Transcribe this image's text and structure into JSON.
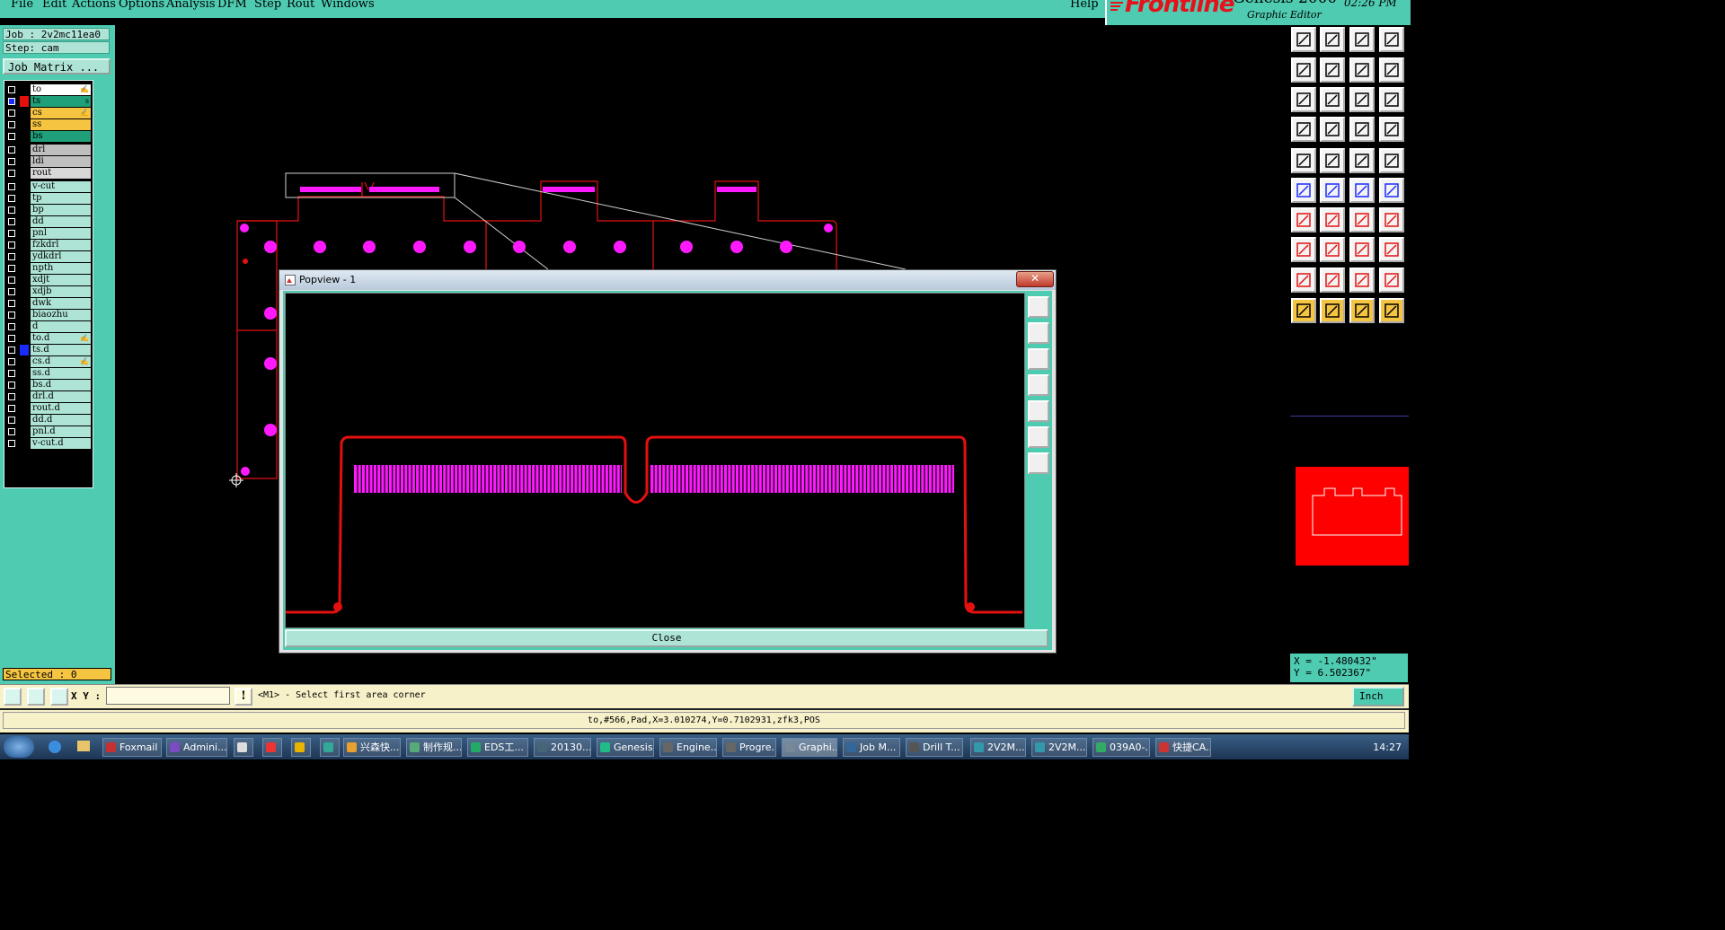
{
  "menu": [
    "File",
    "Edit",
    "Actions",
    "Options",
    "Analysis",
    "DFM",
    "Step",
    "Rout",
    "Windows"
  ],
  "help": "Help",
  "brand": {
    "logo": "Frontline",
    "product": "Genesis 2000",
    "subtitle": "Graphic Editor",
    "time": "02:26 PM"
  },
  "job": {
    "job_label": "Job : 2v2mc11ea0",
    "step_label": "Step: cam",
    "job_matrix": "Job Matrix ..."
  },
  "layers": [
    {
      "name": "to",
      "color": "#ffffff",
      "swatch": "#000000",
      "edit": "✍"
    },
    {
      "name": "ts",
      "color": "#1fa07a",
      "swatch": "#e41010",
      "edit": "s",
      "active": true
    },
    {
      "name": "cs",
      "color": "#f5c542",
      "swatch": "#000000",
      "edit": "✍"
    },
    {
      "name": "ss",
      "color": "#f5c542",
      "swatch": "#000000",
      "edit": ""
    },
    {
      "name": "bs",
      "color": "#1fa07a",
      "swatch": "#000000",
      "edit": ""
    },
    {
      "name": "drl",
      "color": "#bfbfbf",
      "swatch": "#000000",
      "edit": ""
    },
    {
      "name": "ldi",
      "color": "#bfbfbf",
      "swatch": "#000000",
      "edit": ""
    },
    {
      "name": "rout",
      "color": "#d8d8d8",
      "swatch": "#000000",
      "edit": ""
    },
    {
      "name": "v-cut",
      "color": "#aee4d6",
      "swatch": "#000000",
      "edit": ""
    },
    {
      "name": "tp",
      "color": "#aee4d6",
      "swatch": "#000000",
      "edit": ""
    },
    {
      "name": "bp",
      "color": "#aee4d6",
      "swatch": "#000000",
      "edit": ""
    },
    {
      "name": "dd",
      "color": "#aee4d6",
      "swatch": "#000000",
      "edit": ""
    },
    {
      "name": "pnl",
      "color": "#aee4d6",
      "swatch": "#000000",
      "edit": ""
    },
    {
      "name": "fzkdrl",
      "color": "#aee4d6",
      "swatch": "#000000",
      "edit": ""
    },
    {
      "name": "ydkdrl",
      "color": "#aee4d6",
      "swatch": "#000000",
      "edit": ""
    },
    {
      "name": "npth",
      "color": "#aee4d6",
      "swatch": "#000000",
      "edit": ""
    },
    {
      "name": "xdjt",
      "color": "#aee4d6",
      "swatch": "#000000",
      "edit": ""
    },
    {
      "name": "xdjb",
      "color": "#aee4d6",
      "swatch": "#000000",
      "edit": ""
    },
    {
      "name": "dwk",
      "color": "#aee4d6",
      "swatch": "#000000",
      "edit": ""
    },
    {
      "name": "biaozhu",
      "color": "#aee4d6",
      "swatch": "#000000",
      "edit": ""
    },
    {
      "name": "d",
      "color": "#aee4d6",
      "swatch": "#000000",
      "edit": ""
    },
    {
      "name": "to.d",
      "color": "#aee4d6",
      "swatch": "#000000",
      "edit": "✍"
    },
    {
      "name": "ts.d",
      "color": "#aee4d6",
      "swatch": "#1a2bff",
      "edit": ""
    },
    {
      "name": "cs.d",
      "color": "#aee4d6",
      "swatch": "#000000",
      "edit": "✍"
    },
    {
      "name": "ss.d",
      "color": "#aee4d6",
      "swatch": "#000000",
      "edit": ""
    },
    {
      "name": "bs.d",
      "color": "#aee4d6",
      "swatch": "#000000",
      "edit": ""
    },
    {
      "name": "drl.d",
      "color": "#aee4d6",
      "swatch": "#000000",
      "edit": ""
    },
    {
      "name": "rout.d",
      "color": "#aee4d6",
      "swatch": "#000000",
      "edit": ""
    },
    {
      "name": "dd.d",
      "color": "#aee4d6",
      "swatch": "#000000",
      "edit": ""
    },
    {
      "name": "pnl.d",
      "color": "#aee4d6",
      "swatch": "#000000",
      "edit": ""
    },
    {
      "name": "v-cut.d",
      "color": "#aee4d6",
      "swatch": "#000000",
      "edit": ""
    }
  ],
  "selected": "Selected : 0",
  "popview": {
    "title": "Popview - 1",
    "close_x": "✕",
    "close_label": "Close"
  },
  "coords": {
    "x": "X = -1.480432\"",
    "y": "Y = 6.502367\""
  },
  "cmd": {
    "xy_label": "X Y :",
    "xy_value": "",
    "excl": "!",
    "prompt": "<M1> - Select first area corner",
    "unit": "Inch"
  },
  "status": "to,#566,Pad,X=3.010274,Y=0.7102931,zfk3,POS",
  "taskbar": {
    "items": [
      "Foxmail",
      "Admini...",
      "",
      "",
      "",
      "",
      "兴森快...",
      "制作规...",
      "EDS工...",
      "20130...",
      "Genesis",
      "Engine...",
      "Progre...",
      "Graphi...",
      "Job M...",
      "Drill T...",
      "2V2M...",
      "2V2M...",
      "039A0-...",
      "快捷CA..."
    ],
    "clock": "14:27"
  },
  "colors": {
    "teal": "#4ecbb0",
    "pad": "#ff19ff",
    "outline": "#e41010",
    "accent": "#f5c542"
  }
}
